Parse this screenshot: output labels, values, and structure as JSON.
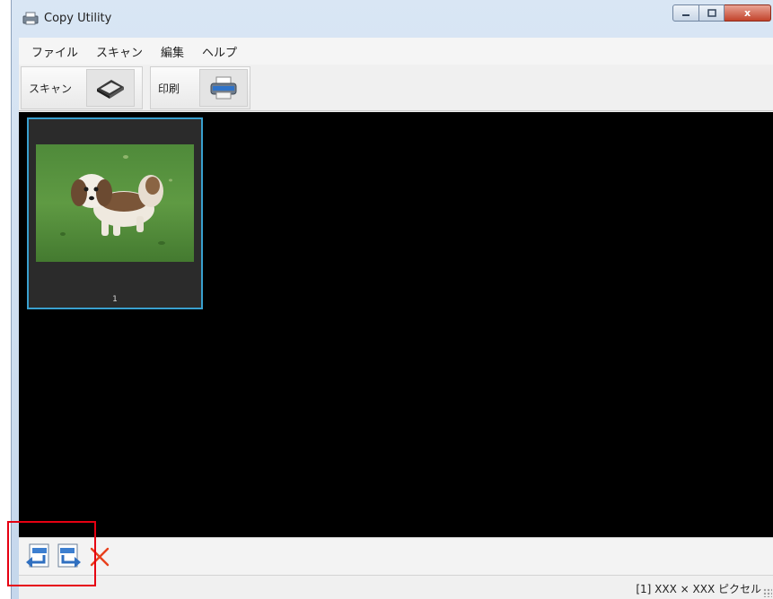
{
  "window": {
    "title": "Copy Utility",
    "min_icon": "minimize-icon",
    "max_icon": "maximize-icon",
    "close_glyph": "x"
  },
  "menu": [
    "ファイル",
    "スキャン",
    "編集",
    "ヘルプ"
  ],
  "toolbar": {
    "scan_label": "スキャン",
    "scan_icon": "scanner-icon",
    "print_label": "印刷",
    "print_icon": "printer-icon"
  },
  "thumbnails": [
    {
      "page_number": "1",
      "selected": true,
      "image": "dog-on-grass-photo"
    }
  ],
  "bottom_tools": {
    "rotate_left_icon": "rotate-left-icon",
    "rotate_right_icon": "rotate-right-icon",
    "delete_icon": "delete-x-icon"
  },
  "status": {
    "text": "[1] XXX × XXX ピクセル"
  },
  "colors": {
    "selection_border": "#39a0cf",
    "highlight": "#e60012",
    "delete_red": "#e8401c"
  }
}
